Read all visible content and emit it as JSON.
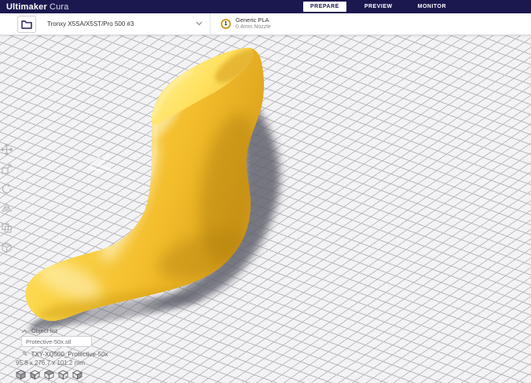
{
  "app": {
    "brand": "Ultimaker",
    "product": "Cura"
  },
  "header": {
    "tabs": [
      {
        "label": "PREPARE",
        "active": true
      },
      {
        "label": "PREVIEW",
        "active": false
      },
      {
        "label": "MONITOR",
        "active": false
      }
    ]
  },
  "toolbar": {
    "printer": {
      "name": "Tronxy X5SA/X5ST/Pro 500 #3"
    },
    "material": {
      "extruder": "1",
      "type": "Generic PLA",
      "nozzle": "0.4mm Nozzle"
    },
    "icons": [
      "folder-icon",
      "chevron-down-icon",
      "extruder-badge"
    ]
  },
  "tools": [
    "move-tool",
    "scale-tool",
    "rotate-tool",
    "mirror-tool",
    "per-model-settings-tool",
    "support-blocker-tool"
  ],
  "object_panel": {
    "header": "Object list",
    "file": "Protective-50x.stl"
  },
  "job": {
    "name": "TXY-XQ500_Protective-50x",
    "dimensions": "95.8 x 276.7 x 101.2 mm"
  },
  "view_presets": [
    "3d-view",
    "front-view",
    "top-view",
    "left-view",
    "right-view"
  ],
  "model": {
    "name": "shoe-last-model",
    "color": "#f6c832"
  },
  "colors": {
    "header_bg": "#1b1850",
    "toolbar_bg": "#ffffff",
    "viewport_bg": "#f3f3f5",
    "grid_line": "#b7b7bd",
    "material_badge_ring": "#c9a227",
    "model_shadow": "#62626d"
  }
}
